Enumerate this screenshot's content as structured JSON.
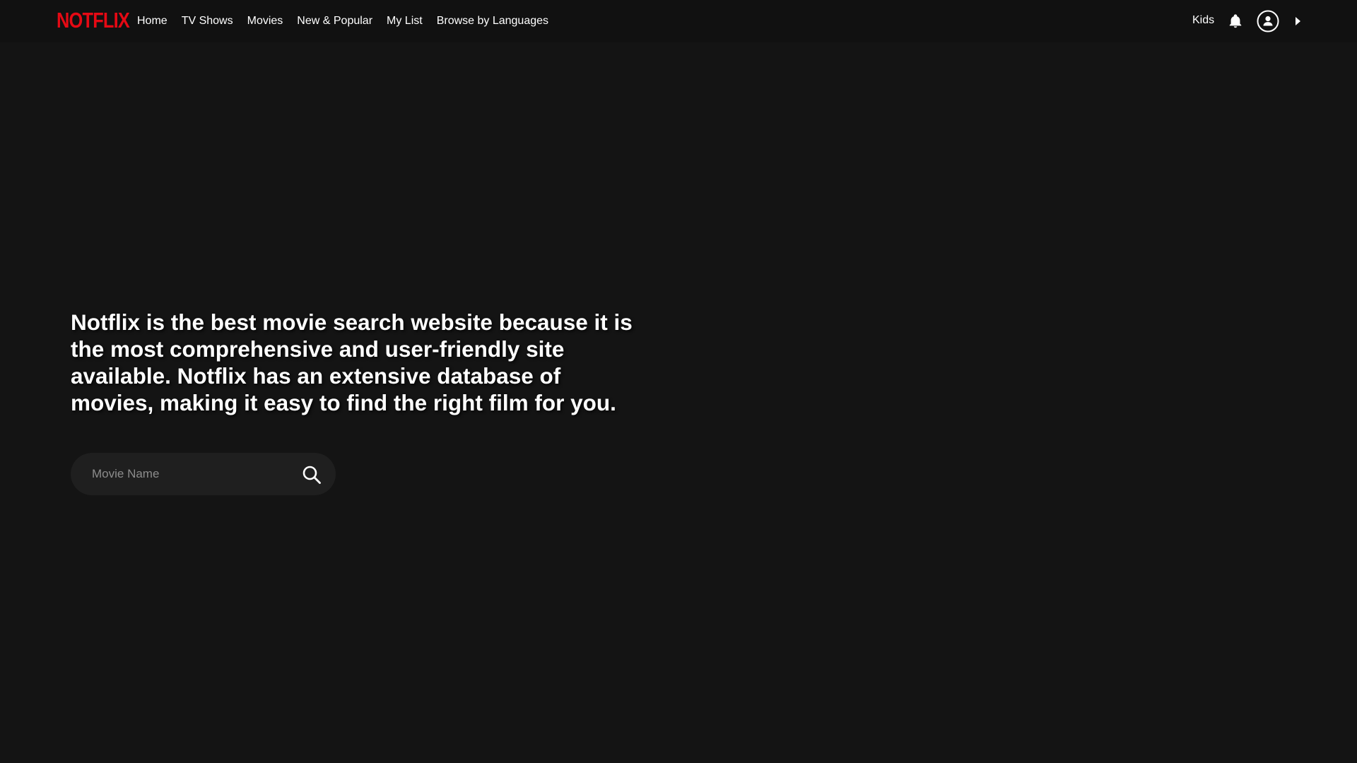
{
  "brand": {
    "logo_text": "NOTFLIX",
    "logo_color": "#e50914"
  },
  "nav": {
    "links": [
      {
        "label": "Home"
      },
      {
        "label": "TV Shows"
      },
      {
        "label": "Movies"
      },
      {
        "label": "New & Popular"
      },
      {
        "label": "My List"
      },
      {
        "label": "Browse by Languages"
      }
    ],
    "kids_label": "Kids",
    "icons": [
      "bell-icon",
      "account-icon",
      "caret-right-icon"
    ]
  },
  "hero": {
    "text": "Notflix is the best movie search website because it is the most comprehensive and user-friendly site available. Notflix has an extensive database of movies, making it easy to find the right film for you."
  },
  "search": {
    "placeholder": "Movie Name",
    "value": "",
    "icon": "search-icon"
  },
  "colors": {
    "background": "#141414",
    "navbar": "#111111",
    "search_bg": "#1f1f1f",
    "text": "#ffffff"
  }
}
